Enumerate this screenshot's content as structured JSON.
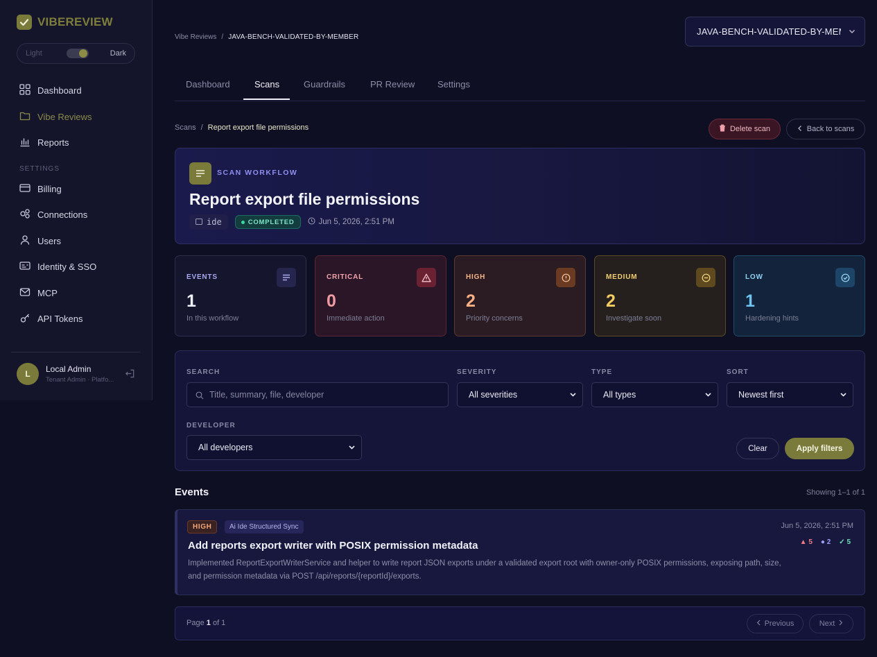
{
  "sidebar": {
    "brand": "VIBEREVIEW",
    "theme": {
      "light": "Light",
      "dark": "Dark"
    },
    "nav": [
      {
        "label": "Dashboard",
        "icon": "grid-icon"
      },
      {
        "label": "Vibe Reviews",
        "icon": "folder-icon",
        "active": true
      },
      {
        "label": "Reports",
        "icon": "bar-chart-icon"
      }
    ],
    "settings_label": "SETTINGS",
    "settings_nav": [
      {
        "label": "Billing",
        "icon": "card-icon"
      },
      {
        "label": "Connections",
        "icon": "nodes-icon"
      },
      {
        "label": "Users",
        "icon": "user-icon"
      },
      {
        "label": "Identity & SSO",
        "icon": "id-card-icon"
      },
      {
        "label": "MCP",
        "icon": "envelope-icon"
      },
      {
        "label": "API Tokens",
        "icon": "key-icon"
      }
    ],
    "user": {
      "initial": "L",
      "name": "Local Admin",
      "role": "Tenant Admin · Platfo..."
    }
  },
  "header": {
    "breadcrumb_root": "Vibe Reviews",
    "breadcrumb_sep": "/",
    "breadcrumb_current": "JAVA-BENCH-VALIDATED-BY-MEMBER",
    "project_select": "JAVA-BENCH-VALIDATED-BY-MEMBER"
  },
  "tabs": [
    "Dashboard",
    "Scans",
    "Guardrails",
    "PR Review",
    "Settings"
  ],
  "subcrumb": {
    "root": "Scans",
    "sep": "/",
    "current": "Report export file permissions"
  },
  "actions": {
    "delete": "Delete scan",
    "back": "Back to scans"
  },
  "hero": {
    "kicker": "SCAN WORKFLOW",
    "title": "Report export file permissions",
    "source": "ide",
    "status": "COMPLETED",
    "date": "Jun 5, 2026, 2:51 PM"
  },
  "stats": {
    "events": {
      "label": "EVENTS",
      "value": "1",
      "sub": "In this workflow"
    },
    "critical": {
      "label": "CRITICAL",
      "value": "0",
      "sub": "Immediate action"
    },
    "high": {
      "label": "HIGH",
      "value": "2",
      "sub": "Priority concerns"
    },
    "medium": {
      "label": "MEDIUM",
      "value": "2",
      "sub": "Investigate soon"
    },
    "low": {
      "label": "LOW",
      "value": "1",
      "sub": "Hardening hints"
    }
  },
  "filters": {
    "search_label": "SEARCH",
    "search_placeholder": "Title, summary, file, developer",
    "severity_label": "SEVERITY",
    "severity_value": "All severities",
    "type_label": "TYPE",
    "type_value": "All types",
    "sort_label": "SORT",
    "sort_value": "Newest first",
    "developer_label": "DEVELOPER",
    "developer_value": "All developers",
    "clear": "Clear",
    "apply": "Apply filters"
  },
  "events": {
    "title": "Events",
    "showing": "Showing 1–1 of 1",
    "items": [
      {
        "severity": "HIGH",
        "source": "Ai Ide Structured Sync",
        "date": "Jun 5, 2026, 2:51 PM",
        "title": "Add reports export writer with POSIX permission metadata",
        "description": "Implemented ReportExportWriterService and helper to write report JSON exports under a validated export root with owner-only POSIX permissions, exposing path, size, and permission metadata via POST /api/reports/{reportId}/exports.",
        "metric_a": "5",
        "metric_b": "2",
        "metric_c": "5"
      }
    ]
  },
  "pagination": {
    "prefix": "Page",
    "page": "1",
    "of": "of 1",
    "prev": "Previous",
    "next": "Next"
  },
  "colors": {
    "accent": "#7a7a3a",
    "background": "#0f0f24",
    "panel": "#15153a"
  }
}
